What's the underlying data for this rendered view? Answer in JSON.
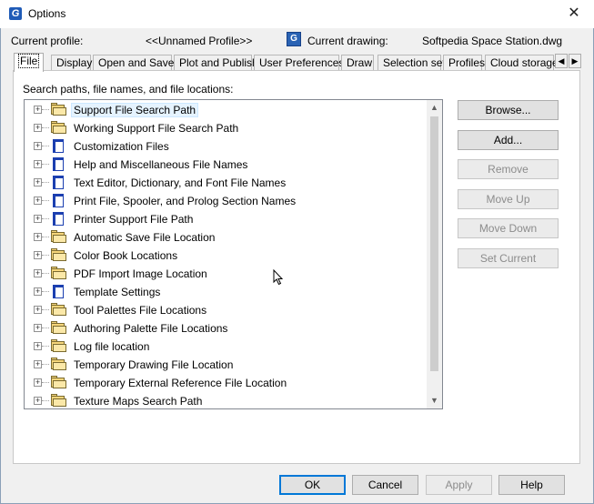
{
  "window": {
    "title": "Options",
    "app_icon": "G",
    "close_glyph": "✕"
  },
  "profile": {
    "current_profile_label": "Current profile:",
    "current_profile_value": "<<Unnamed Profile>>",
    "current_drawing_label": "Current drawing:",
    "current_drawing_value": "Softpedia Space Station.dwg",
    "drawing_icon_glyph": "G"
  },
  "tabs": [
    "File",
    "Display",
    "Open and Save",
    "Plot and Publish",
    "User Preferences",
    "Draw",
    "Selection set",
    "Profiles",
    "Cloud storage"
  ],
  "tab_scroll": {
    "left": "◀",
    "right": "▶"
  },
  "section_label": "Search paths, file names, and file locations:",
  "tree": {
    "expander_glyph": "+",
    "items": [
      {
        "label": "Support File Search Path",
        "icon": "folder-icon",
        "selected": true
      },
      {
        "label": "Working Support File Search Path",
        "icon": "folder-icon"
      },
      {
        "label": "Customization Files",
        "icon": "page-icon"
      },
      {
        "label": "Help and Miscellaneous File Names",
        "icon": "page-icon"
      },
      {
        "label": "Text Editor, Dictionary, and Font File Names",
        "icon": "page-icon"
      },
      {
        "label": "Print File, Spooler, and Prolog Section Names",
        "icon": "page-icon"
      },
      {
        "label": "Printer Support File Path",
        "icon": "page-icon"
      },
      {
        "label": "Automatic Save File Location",
        "icon": "folder-icon"
      },
      {
        "label": "Color Book Locations",
        "icon": "folder-icon"
      },
      {
        "label": "PDF Import Image Location",
        "icon": "folder-icon"
      },
      {
        "label": "Template Settings",
        "icon": "page-icon"
      },
      {
        "label": "Tool Palettes File Locations",
        "icon": "folder-icon"
      },
      {
        "label": "Authoring Palette File Locations",
        "icon": "folder-icon"
      },
      {
        "label": "Log file location",
        "icon": "folder-icon"
      },
      {
        "label": "Temporary Drawing File Location",
        "icon": "folder-icon"
      },
      {
        "label": "Temporary External Reference File Location",
        "icon": "folder-icon"
      },
      {
        "label": "Texture Maps Search Path",
        "icon": "folder-icon"
      }
    ],
    "scroll_up": "▲",
    "scroll_down": "▼"
  },
  "side_buttons": [
    {
      "label": "Browse...",
      "enabled": true
    },
    {
      "label": "Add...",
      "enabled": true
    },
    {
      "label": "Remove",
      "enabled": false
    },
    {
      "label": "Move Up",
      "enabled": false
    },
    {
      "label": "Move Down",
      "enabled": false
    },
    {
      "label": "Set Current",
      "enabled": false
    }
  ],
  "footer_buttons": [
    {
      "label": "OK",
      "enabled": true,
      "default": true
    },
    {
      "label": "Cancel",
      "enabled": true
    },
    {
      "label": "Apply",
      "enabled": false
    },
    {
      "label": "Help",
      "enabled": true
    }
  ],
  "colors": {
    "accent": "#0078d7",
    "folder": "#f5d57a",
    "page": "#1b3fb0"
  }
}
